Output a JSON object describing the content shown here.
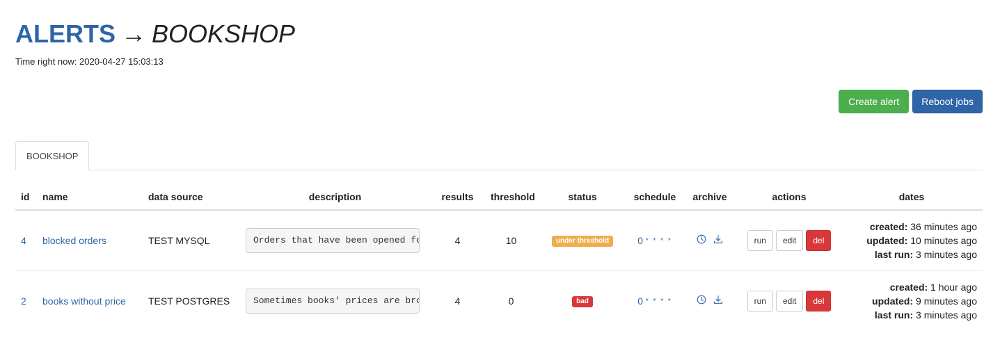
{
  "header": {
    "root": "ALERTS",
    "arrow": "→",
    "current": "BOOKSHOP",
    "time_prefix": "Time right now:",
    "time_value": "2020-04-27 15:03:13"
  },
  "toolbar": {
    "create_label": "Create alert",
    "reboot_label": "Reboot jobs"
  },
  "tabs": [
    {
      "label": "BOOKSHOP",
      "active": true
    }
  ],
  "table": {
    "columns": {
      "id": "id",
      "name": "name",
      "data_source": "data source",
      "description": "description",
      "results": "results",
      "threshold": "threshold",
      "status": "status",
      "schedule": "schedule",
      "archive": "archive",
      "actions": "actions",
      "dates": "dates"
    },
    "rows": [
      {
        "id": "4",
        "name": "blocked orders",
        "data_source": "TEST MYSQL",
        "description": "Orders that have been opened fo",
        "results": "4",
        "threshold": "10",
        "status": "under threshold",
        "status_color": "#f0ad4e",
        "schedule_zero": "0",
        "schedule_stars": "* * * *",
        "actions": {
          "run": "run",
          "edit": "edit",
          "del": "del"
        },
        "dates": {
          "created_label": "created:",
          "created": "36 minutes ago",
          "updated_label": "updated:",
          "updated": "10 minutes ago",
          "last_run_label": "last run:",
          "last_run": "3 minutes ago"
        }
      },
      {
        "id": "2",
        "name": "books without price",
        "data_source": "TEST POSTGRES",
        "description": "Sometimes books' prices are bro",
        "results": "4",
        "threshold": "0",
        "status": "bad",
        "status_color": "#d9383a",
        "schedule_zero": "0",
        "schedule_stars": "* * * *",
        "actions": {
          "run": "run",
          "edit": "edit",
          "del": "del"
        },
        "dates": {
          "created_label": "created:",
          "created": "1 hour ago",
          "updated_label": "updated:",
          "updated": "9 minutes ago",
          "last_run_label": "last run:",
          "last_run": "3 minutes ago"
        }
      }
    ]
  },
  "icons": {
    "history": "clock-icon",
    "download": "download-icon"
  },
  "colors": {
    "link": "#2f64a7",
    "success": "#4cae4c",
    "primary": "#2f64a7",
    "danger": "#d9383a",
    "warning": "#f0ad4e"
  }
}
